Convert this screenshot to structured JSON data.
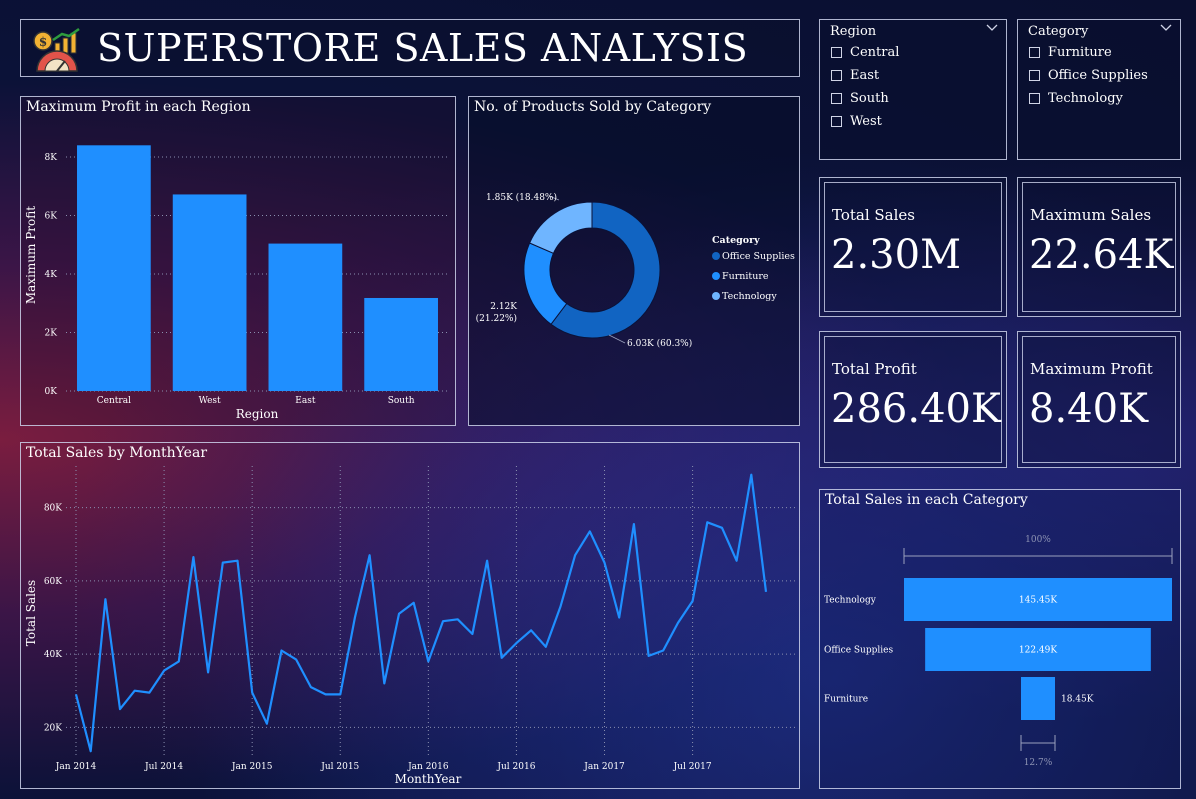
{
  "page": {
    "title": "SUPERSTORE SALES ANALYSIS",
    "logo_icon": "money-growth-icon"
  },
  "slicers": {
    "region": {
      "label": "Region",
      "options": [
        "Central",
        "East",
        "South",
        "West"
      ]
    },
    "category": {
      "label": "Category",
      "options": [
        "Furniture",
        "Office Supplies",
        "Technology"
      ]
    }
  },
  "kpis": [
    {
      "label": "Total Sales",
      "value": "2.30M"
    },
    {
      "label": "Maximum Sales",
      "value": "22.64K"
    },
    {
      "label": "Total Profit",
      "value": "286.40K"
    },
    {
      "label": "Maximum Profit",
      "value": "8.40K"
    }
  ],
  "colors": {
    "bar": "#1f8fff",
    "office_supplies": "#1164c2",
    "furniture": "#1f8fff",
    "technology": "#6fb5ff",
    "grid": "#8a90b0"
  },
  "chart_data": [
    {
      "type": "bar",
      "title": "Maximum Profit in each Region",
      "xlabel": "Region",
      "ylabel": "Maximum Profit",
      "categories": [
        "Central",
        "West",
        "East",
        "South"
      ],
      "values": [
        8400,
        6720,
        5040,
        3180
      ],
      "yticks": [
        "0K",
        "2K",
        "4K",
        "6K",
        "8K"
      ],
      "ylim": [
        0,
        8000
      ],
      "grid": true
    },
    {
      "type": "pie",
      "title": "No. of Products Sold by Category",
      "legend_title": "Category",
      "legend_position": "right",
      "slices": [
        {
          "name": "Office Supplies",
          "value": 6030,
          "label": "6.03K (60.3%)"
        },
        {
          "name": "Furniture",
          "value": 2120,
          "label": "2.12K (21.22%)"
        },
        {
          "name": "Technology",
          "value": 1850,
          "label": "1.85K (18.48%)"
        }
      ]
    },
    {
      "type": "line",
      "title": "Total Sales by MonthYear",
      "xlabel": "MonthYear",
      "ylabel": "Total Sales",
      "xticks": [
        "Jan 2014",
        "Jul 2014",
        "Jan 2015",
        "Jul 2015",
        "Jan 2016",
        "Jul 2016",
        "Jan 2017",
        "Jul 2017"
      ],
      "yticks": [
        "20K",
        "40K",
        "60K",
        "80K"
      ],
      "ylim": [
        13000,
        90000
      ],
      "grid": true,
      "x": [
        "2014-01",
        "2014-02",
        "2014-03",
        "2014-04",
        "2014-05",
        "2014-06",
        "2014-07",
        "2014-08",
        "2014-09",
        "2014-10",
        "2014-11",
        "2014-12",
        "2015-01",
        "2015-02",
        "2015-03",
        "2015-04",
        "2015-05",
        "2015-06",
        "2015-07",
        "2015-08",
        "2015-09",
        "2015-10",
        "2015-11",
        "2015-12",
        "2016-01",
        "2016-02",
        "2016-03",
        "2016-04",
        "2016-05",
        "2016-06",
        "2016-07",
        "2016-08",
        "2016-09",
        "2016-10",
        "2016-11",
        "2016-12",
        "2017-01",
        "2017-02",
        "2017-03",
        "2017-04",
        "2017-05",
        "2017-06",
        "2017-07",
        "2017-08",
        "2017-09",
        "2017-10",
        "2017-11",
        "2017-12"
      ],
      "values": [
        29000,
        13500,
        55000,
        25000,
        30000,
        29500,
        35500,
        38000,
        66500,
        35000,
        65000,
        65500,
        29500,
        21000,
        41000,
        38500,
        31000,
        29000,
        29000,
        50000,
        67000,
        32000,
        51000,
        54000,
        38000,
        49000,
        49500,
        45500,
        65500,
        39000,
        43000,
        46500,
        42000,
        53000,
        67000,
        73500,
        65000,
        50000,
        75500,
        39500,
        41000,
        48500,
        54500,
        76000,
        74500,
        65500,
        89000,
        57000
      ]
    },
    {
      "type": "funnel",
      "title": "Total Sales in each Category",
      "top_label": "100%",
      "bottom_label": "12.7%",
      "categories": [
        "Technology",
        "Office Supplies",
        "Furniture"
      ],
      "values": [
        145450,
        122490,
        18450
      ],
      "labels": [
        "145.45K",
        "122.49K",
        "18.45K"
      ]
    }
  ]
}
